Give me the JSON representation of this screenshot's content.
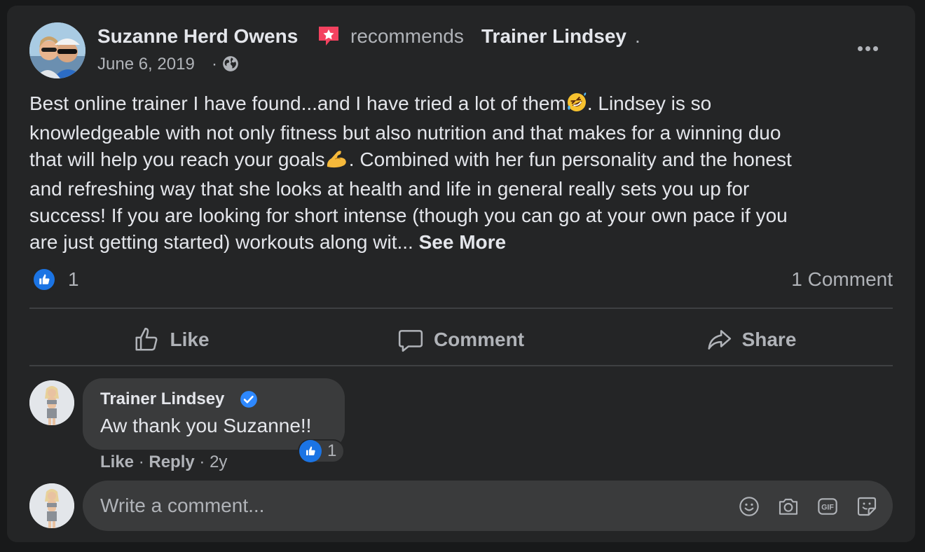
{
  "post": {
    "author": "Suzanne Herd Owens",
    "verb": "recommends",
    "page": "Trainer Lindsey",
    "page_suffix": ".",
    "date": "June 6, 2019",
    "date_sep": "·",
    "privacy_icon": "globe-icon",
    "menu_icon": "more-horizontal-icon",
    "body_lines": [
      "Best online trainer I have found...and I have tried a lot of them",
      ".  Lindsey is so",
      "knowledgeable with not only fitness but also nutrition and that makes for a winning duo",
      "that will help you reach your goals",
      ".  Combined with her fun personality and the honest",
      "and refreshing way that she looks at health and life in general really sets you up for",
      "success!  If you are looking for short intense (though you can go at your own pace if you",
      "are just getting started) workouts along wit... "
    ],
    "see_more": "See More",
    "emojis": [
      "rolling-on-floor-laughing-emoji",
      "flexed-biceps-emoji"
    ]
  },
  "reactions": {
    "icon": "thumbs-up-icon",
    "count": "1",
    "comments_label": "1 Comment"
  },
  "actions": {
    "like": "Like",
    "comment": "Comment",
    "share": "Share"
  },
  "comment": {
    "author": "Trainer Lindsey",
    "verified_icon": "verified-badge-icon",
    "text": "Aw thank you Suzanne!!",
    "reaction_count": "1",
    "like": "Like",
    "reply": "Reply",
    "sep": "·",
    "age": "2y"
  },
  "composer": {
    "placeholder": "Write a comment...",
    "icons": [
      "emoji-icon",
      "camera-icon",
      "gif-icon",
      "sticker-icon"
    ]
  },
  "colors": {
    "card": "#242526",
    "bubble": "#3a3b3c",
    "primary_text": "#e4e6eb",
    "secondary_text": "#b0b3b8",
    "like_blue": "#1b74e4",
    "recommend_red": "#f3425f"
  }
}
